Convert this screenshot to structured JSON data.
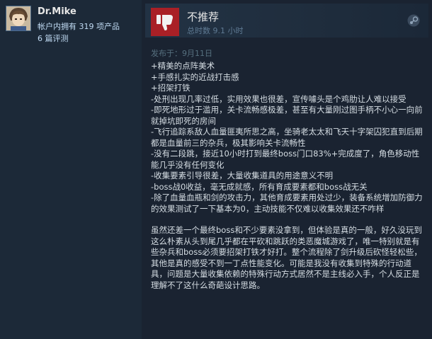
{
  "user": {
    "name": "Dr.Mike",
    "products_owned": "帐户内拥有 319 项产品",
    "reviews_count": "6 篇评测"
  },
  "review": {
    "verdict": "不推荐",
    "hours": "总时数 9.1 小时",
    "posted": "发布于：9月11日",
    "lines": [
      "+精美的点阵美术",
      "+手感扎实的近战打击感",
      "+招架打铁",
      "-处刑出现几率过低，实用效果也很差，宣传噱头是个鸡肋让人难以接受",
      "-即死地形过于滥用，关卡流畅感极差，甚至有大量刚过图手柄不小心一向前就掉坑即死的房间",
      "-飞行追踪系敌人血量匪夷所思之高，坐骑老太太和飞天十字架囚犯直到后期都是血量前三的杂兵，极其影响关卡流畅性",
      "-没有二段跳，接近10小时打到最终boss门口83%+完成度了，角色移动性能几乎没有任何变化",
      "-收集要素引导很差，大量收集道具的用途意义不明",
      "-boss战0收益，毫无成就感，所有育成要素都和boss战无关",
      "-除了血量血瓶和剑的攻击力，其他育成要素用处过少，装备系统增加防御力的效果测试了一下基本为0，主动技能不仅难以收集效果还不咋样"
    ],
    "summary": "虽然还差一个最终boss和不少要素没拿到，但体验是真的一般，好久没玩到这么朴素从头到尾几乎都在平砍和跳跃的类恶魔城游戏了，唯一特别就是有些杂兵和boss必须要招架打铁才好打。整个流程除了剑升级后砍怪轻松些，其他是真的感受不到一丁点性能变化。可能是我没有收集到特殊的行动道具，问题是大量收集依赖的特殊行动方式居然不是主线必入手，个人反正是理解不了这什么奇葩设计思路。"
  },
  "icons": {
    "thumb": "thumbs-down-icon",
    "steam": "steam-icon",
    "avatar": "avatar"
  },
  "colors": {
    "background": "#1a2331",
    "thumb_bg": "#a92026",
    "link": "#c1dbf4"
  }
}
